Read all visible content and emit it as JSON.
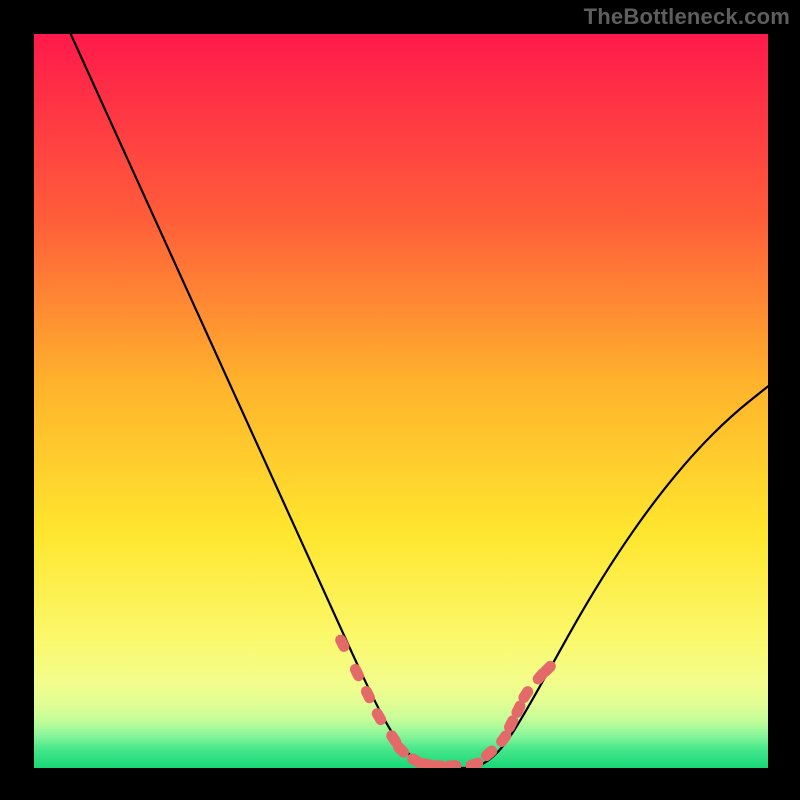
{
  "watermark": {
    "text": "TheBottleneck.com"
  },
  "chart_data": {
    "type": "line",
    "title": "",
    "xlabel": "",
    "ylabel": "",
    "xlim": [
      0,
      100
    ],
    "ylim": [
      0,
      100
    ],
    "series": [
      {
        "name": "curve",
        "x": [
          5,
          10,
          15,
          20,
          25,
          30,
          35,
          40,
          45,
          48,
          50,
          52,
          54,
          56,
          58,
          60,
          62,
          64,
          66,
          70,
          75,
          80,
          85,
          90,
          95,
          100
        ],
        "y": [
          100,
          89,
          78,
          67,
          56,
          45,
          34,
          23,
          12,
          6,
          3,
          1,
          0,
          0,
          0,
          0,
          1,
          3,
          6,
          13,
          22,
          30,
          37,
          43,
          48,
          52
        ]
      }
    ],
    "markers": {
      "name": "highlighted-points",
      "color": "#e46a6a",
      "x": [
        42,
        44,
        45.5,
        47,
        49,
        50,
        52,
        53.5,
        55,
        57,
        60,
        62,
        64,
        65,
        66,
        67,
        69,
        70
      ],
      "y": [
        17,
        13,
        10,
        7,
        4,
        2.5,
        1,
        0.5,
        0.3,
        0.3,
        0.5,
        2,
        4,
        6,
        8,
        10,
        12.5,
        13.5
      ]
    },
    "gradient_stops": [
      {
        "pct": 0,
        "color": "#ff1a4b"
      },
      {
        "pct": 25,
        "color": "#ff5d3a"
      },
      {
        "pct": 48,
        "color": "#ffb42c"
      },
      {
        "pct": 68,
        "color": "#ffe62e"
      },
      {
        "pct": 82,
        "color": "#fbf86a"
      },
      {
        "pct": 88,
        "color": "#f3fd8a"
      },
      {
        "pct": 91,
        "color": "#e3fd93"
      },
      {
        "pct": 93.5,
        "color": "#c3fd99"
      },
      {
        "pct": 95.5,
        "color": "#8cf69b"
      },
      {
        "pct": 97.5,
        "color": "#45e68a"
      },
      {
        "pct": 100,
        "color": "#17d877"
      }
    ]
  }
}
